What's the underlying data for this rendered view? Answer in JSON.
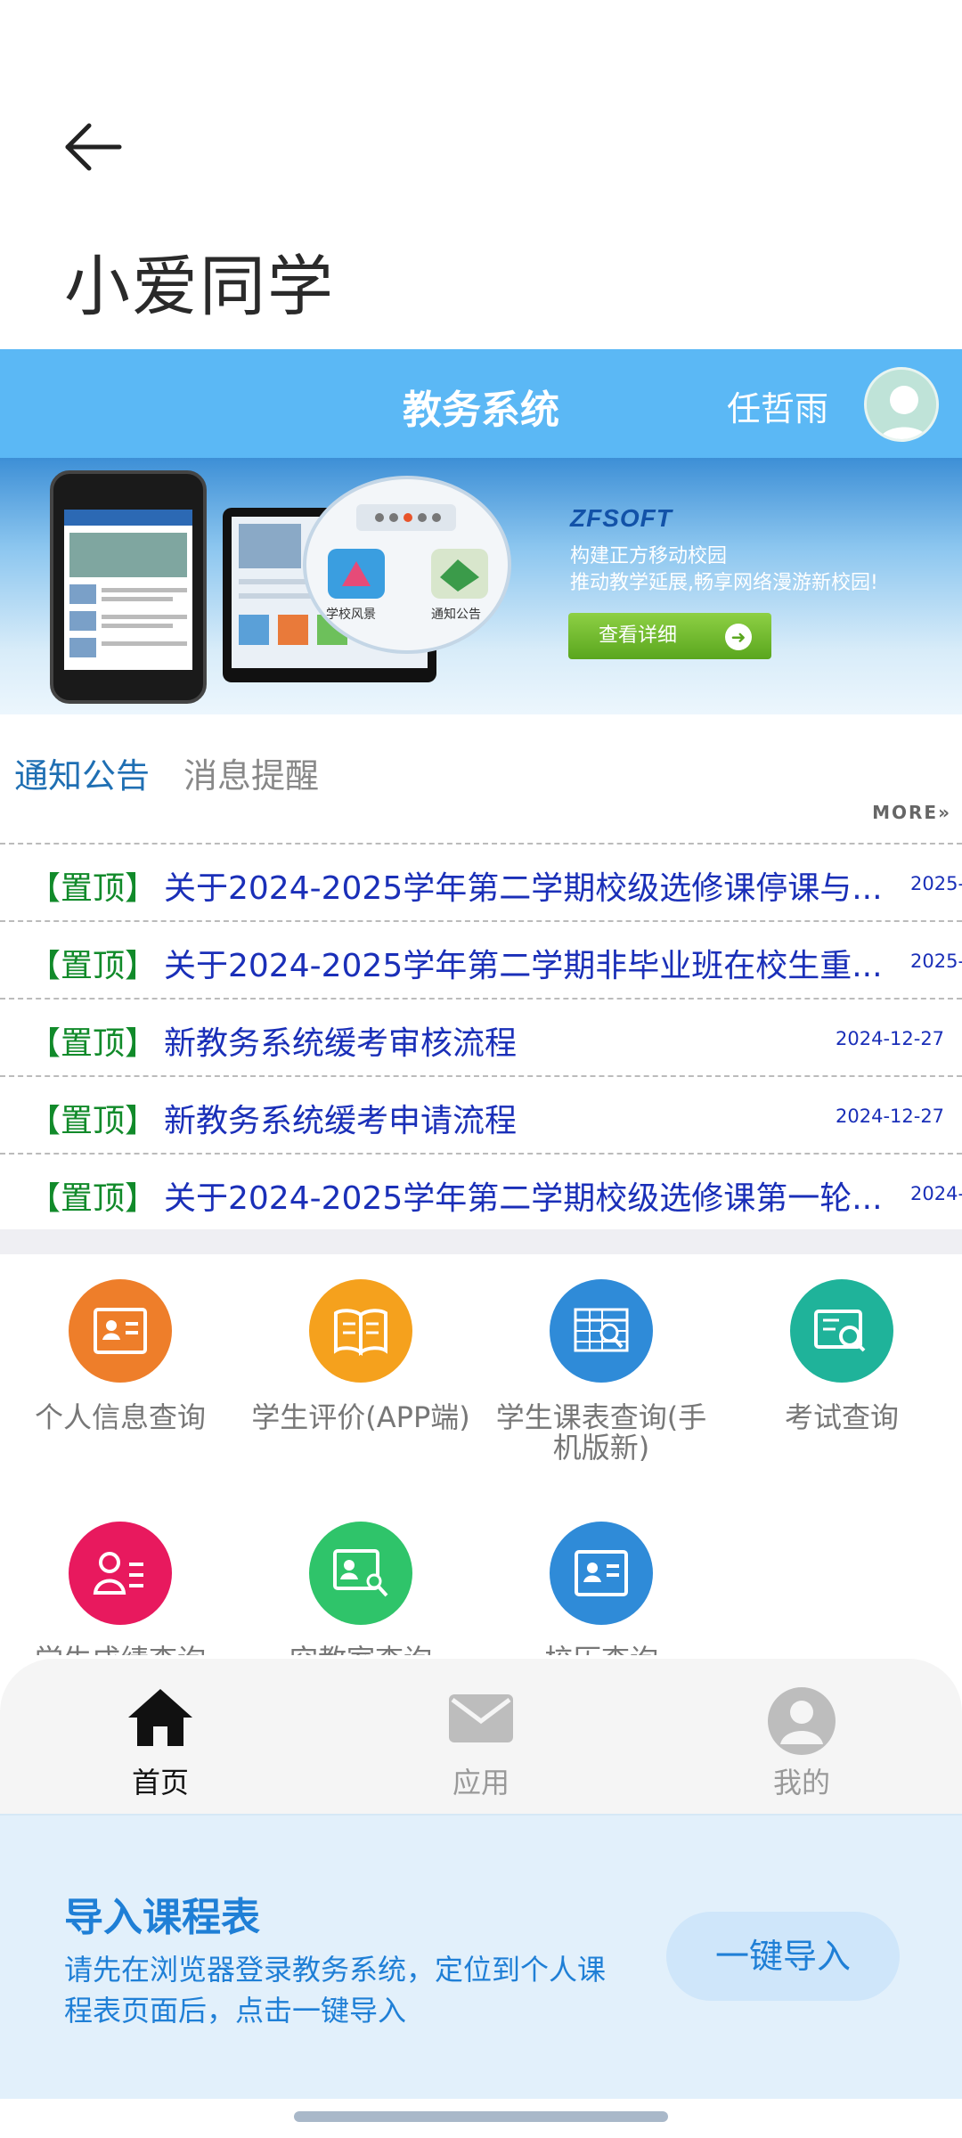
{
  "app_bar": {
    "title": "小爱同学"
  },
  "webview": {
    "title": "教务系统",
    "user_name": "任哲雨",
    "banner": {
      "brand": "ZFSOFT",
      "line1": "构建正方移动校园",
      "line2": "推动教学延展,畅享网络漫游新校园!",
      "button": "查看详细"
    },
    "tabs": [
      "通知公告",
      "消息提醒"
    ],
    "more": "MORE»",
    "notices": [
      {
        "tag": "【置顶】",
        "title": "关于2024-2025学年第二学期校级选修课停课与...",
        "date": "2025-"
      },
      {
        "tag": "【置顶】",
        "title": "关于2024-2025学年第二学期非毕业班在校生重...",
        "date": "2025-"
      },
      {
        "tag": "【置顶】",
        "title": "新教务系统缓考审核流程",
        "date": "2024-12-27"
      },
      {
        "tag": "【置顶】",
        "title": "新教务系统缓考申请流程",
        "date": "2024-12-27"
      },
      {
        "tag": "【置顶】",
        "title": "关于2024-2025学年第二学期校级选修课第一轮...",
        "date": "2024-"
      }
    ],
    "apps": [
      {
        "label": "个人信息查询",
        "icon": "id-card-icon",
        "color": "#ee7e2a"
      },
      {
        "label": "学生评价(APP端)",
        "icon": "book-icon",
        "color": "#f5a11d"
      },
      {
        "label": "学生课表查询(手机版新)",
        "icon": "timetable-search-icon",
        "color": "#2f8bd8"
      },
      {
        "label": "考试查询",
        "icon": "exam-search-icon",
        "color": "#1fb39a"
      },
      {
        "label": "学生成绩查询",
        "icon": "grade-list-icon",
        "color": "#e8195e"
      },
      {
        "label": "空教室查询",
        "icon": "certificate-key-icon",
        "color": "#2fc46a"
      },
      {
        "label": "校历查询",
        "icon": "card-icon",
        "color": "#2f8bd8"
      }
    ]
  },
  "bottom_nav": {
    "items": [
      {
        "label": "首页",
        "icon": "home-icon",
        "active": true
      },
      {
        "label": "应用",
        "icon": "mail-icon",
        "active": false
      },
      {
        "label": "我的",
        "icon": "profile-icon",
        "active": false
      }
    ]
  },
  "import_card": {
    "title": "导入课程表",
    "description": "请先在浏览器登录教务系统，定位到个人课程表页面后，点击一键导入",
    "button": "一键导入"
  }
}
